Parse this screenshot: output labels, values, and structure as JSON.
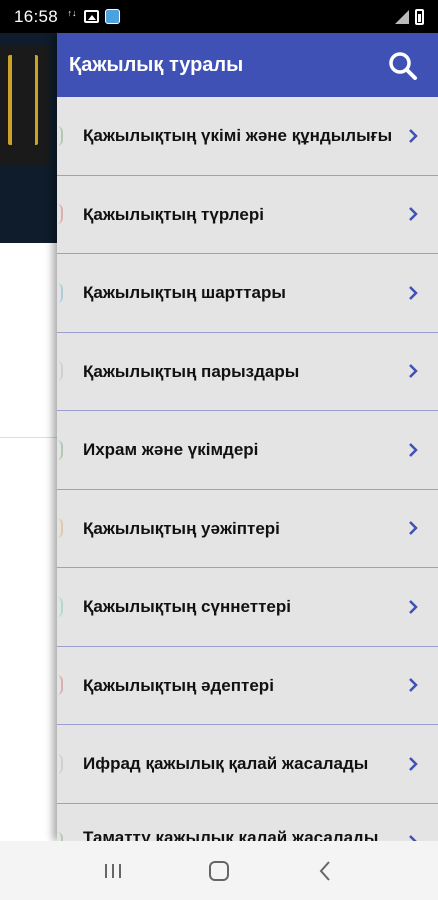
{
  "status_bar": {
    "time": "16:58"
  },
  "drawer": {
    "title": "Қажылық туралы",
    "items": [
      {
        "label": "Қажылықтың үкімі және құндылығы"
      },
      {
        "label": "Қажылықтың түрлері"
      },
      {
        "label": "Қажылықтың шарттары"
      },
      {
        "label": "Қажылықтың парыздары"
      },
      {
        "label": "Ихрам және үкімдері"
      },
      {
        "label": "Қажылықтың уәжіптері"
      },
      {
        "label": "Қажылықтың сүннеттері"
      },
      {
        "label": "Қажылықтың әдептері"
      },
      {
        "label": "Ифрад қажылық қалай жасалады"
      },
      {
        "label": "Таматту қажылық қалай жасалады"
      }
    ]
  },
  "colors": {
    "app_bar": "#3f51b5",
    "drawer_bg": "#e4e4e4",
    "divider": "#9a9fd0",
    "status_bar": "#000000"
  },
  "icons": {
    "search": "search-icon",
    "chevron": "chevron-right-icon",
    "nav_recents": "recents-icon",
    "nav_home": "home-icon",
    "nav_back": "back-icon"
  }
}
